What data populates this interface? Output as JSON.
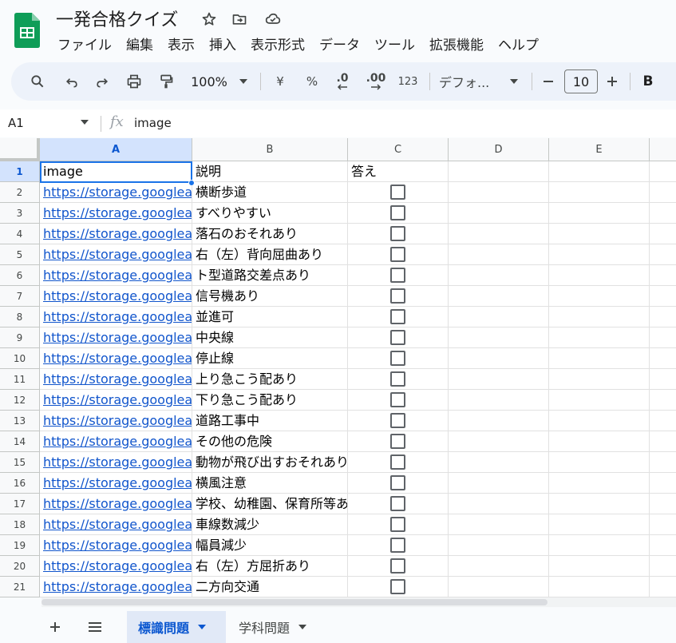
{
  "app": {
    "doc_title": "一発合格クイズ",
    "menu": [
      "ファイル",
      "編集",
      "表示",
      "挿入",
      "表示形式",
      "データ",
      "ツール",
      "拡張機能",
      "ヘルプ"
    ]
  },
  "toolbar": {
    "zoom": "100%",
    "currency": "¥",
    "percent": "%",
    "decrease_decimal": ".0",
    "increase_decimal": ".00",
    "number_format": "123",
    "font": "デフォ...",
    "font_size": "10",
    "bold": "B"
  },
  "formula_bar": {
    "name_box": "A1",
    "fx": "fx",
    "content": "image"
  },
  "columns": [
    "A",
    "B",
    "C",
    "D",
    "E"
  ],
  "header_row": {
    "num": "1",
    "a": "image",
    "b": "説明",
    "c": "答え"
  },
  "rows": [
    {
      "num": "2",
      "url": "https://storage.googleapis",
      "desc": "横断歩道"
    },
    {
      "num": "3",
      "url": "https://storage.googleapis",
      "desc": "すべりやすい"
    },
    {
      "num": "4",
      "url": "https://storage.googleapis",
      "desc": "落石のおそれあり"
    },
    {
      "num": "5",
      "url": "https://storage.googleapis",
      "desc": "右（左）背向屈曲あり"
    },
    {
      "num": "6",
      "url": "https://storage.googleapis",
      "desc": "ト型道路交差点あり"
    },
    {
      "num": "7",
      "url": "https://storage.googleapis",
      "desc": "信号機あり"
    },
    {
      "num": "8",
      "url": "https://storage.googleapis",
      "desc": "並進可"
    },
    {
      "num": "9",
      "url": "https://storage.googleapis",
      "desc": "中央線"
    },
    {
      "num": "10",
      "url": "https://storage.googleapis",
      "desc": "停止線"
    },
    {
      "num": "11",
      "url": "https://storage.googleapis",
      "desc": "上り急こう配あり"
    },
    {
      "num": "12",
      "url": "https://storage.googleapis",
      "desc": "下り急こう配あり"
    },
    {
      "num": "13",
      "url": "https://storage.googleapis",
      "desc": "道路工事中"
    },
    {
      "num": "14",
      "url": "https://storage.googleapis",
      "desc": "その他の危険"
    },
    {
      "num": "15",
      "url": "https://storage.googleapis",
      "desc": "動物が飛び出すおそれあり"
    },
    {
      "num": "16",
      "url": "https://storage.googleapis",
      "desc": "横風注意"
    },
    {
      "num": "17",
      "url": "https://storage.googleapis",
      "desc": "学校、幼稚園、保育所等あ"
    },
    {
      "num": "18",
      "url": "https://storage.googleapis",
      "desc": "車線数減少"
    },
    {
      "num": "19",
      "url": "https://storage.googleapis",
      "desc": "幅員減少"
    },
    {
      "num": "20",
      "url": "https://storage.googleapis",
      "desc": "右（左）方屈折あり"
    },
    {
      "num": "21",
      "url": "https://storage.googleapis",
      "desc": "二方向交通"
    }
  ],
  "sheets": [
    {
      "label": "標識問題",
      "active": true
    },
    {
      "label": "学科問題",
      "active": false
    }
  ],
  "colors": {
    "accent": "#0b57d0",
    "link": "#1155cc",
    "sheets_green": "#0f9d58"
  }
}
